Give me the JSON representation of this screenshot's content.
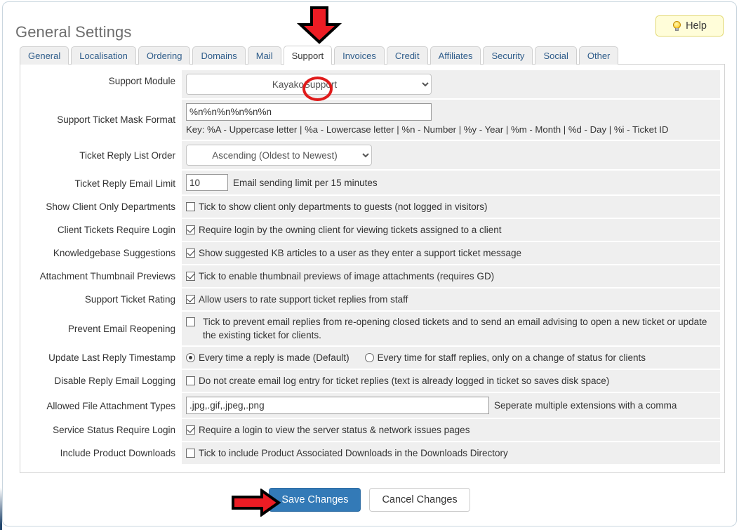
{
  "page": {
    "title": "General Settings",
    "help_button": {
      "label": "Help",
      "icon": "lightbulb-icon"
    }
  },
  "tabs": [
    {
      "label": "General",
      "active": false
    },
    {
      "label": "Localisation",
      "active": false
    },
    {
      "label": "Ordering",
      "active": false
    },
    {
      "label": "Domains",
      "active": false
    },
    {
      "label": "Mail",
      "active": false
    },
    {
      "label": "Support",
      "active": true
    },
    {
      "label": "Invoices",
      "active": false
    },
    {
      "label": "Credit",
      "active": false
    },
    {
      "label": "Affiliates",
      "active": false
    },
    {
      "label": "Security",
      "active": false
    },
    {
      "label": "Social",
      "active": false
    },
    {
      "label": "Other",
      "active": false
    }
  ],
  "settings": {
    "support_module": {
      "label": "Support Module",
      "value": "KayakoSupport",
      "options": [
        "KayakoSupport"
      ]
    },
    "ticket_mask_format": {
      "label": "Support Ticket Mask Format",
      "value": "%n%n%n%n%n%n",
      "key_note": "Key: %A - Uppercase letter | %a - Lowercase letter | %n - Number | %y - Year | %m - Month | %d - Day | %i - Ticket ID"
    },
    "reply_list_order": {
      "label": "Ticket Reply List Order",
      "value": "Ascending (Oldest to Newest)",
      "options": [
        "Ascending (Oldest to Newest)"
      ]
    },
    "reply_email_limit": {
      "label": "Ticket Reply Email Limit",
      "value": "10",
      "suffix": "Email sending limit per 15 minutes"
    },
    "show_client_only_departments": {
      "label": "Show Client Only Departments",
      "checked": false,
      "description": "Tick to show client only departments to guests (not logged in visitors)"
    },
    "client_tickets_require_login": {
      "label": "Client Tickets Require Login",
      "checked": true,
      "description": "Require login by the owning client for viewing tickets assigned to a client"
    },
    "knowledgebase_suggestions": {
      "label": "Knowledgebase Suggestions",
      "checked": true,
      "description": "Show suggested KB articles to a user as they enter a support ticket message"
    },
    "attachment_thumbnail_previews": {
      "label": "Attachment Thumbnail Previews",
      "checked": true,
      "description": "Tick to enable thumbnail previews of image attachments (requires GD)"
    },
    "support_ticket_rating": {
      "label": "Support Ticket Rating",
      "checked": true,
      "description": "Allow users to rate support ticket replies from staff"
    },
    "prevent_email_reopening": {
      "label": "Prevent Email Reopening",
      "checked": false,
      "description": "Tick to prevent email replies from re-opening closed tickets and to send an email advising to open a new ticket or update the existing ticket for clients."
    },
    "update_last_reply_timestamp": {
      "label": "Update Last Reply Timestamp",
      "option_1": "Every time a reply is made (Default)",
      "option_1_selected": true,
      "option_2": "Every time for staff replies, only on a change of status for clients",
      "option_2_selected": false
    },
    "disable_reply_email_logging": {
      "label": "Disable Reply Email Logging",
      "checked": false,
      "description": "Do not create email log entry for ticket replies (text is already logged in ticket so saves disk space)"
    },
    "allowed_file_attachment_types": {
      "label": "Allowed File Attachment Types",
      "value": ".jpg,.gif,.jpeg,.png",
      "suffix": "Seperate multiple extensions with a comma"
    },
    "service_status_require_login": {
      "label": "Service Status Require Login",
      "checked": true,
      "description": "Require a login to view the server status & network issues pages"
    },
    "include_product_downloads": {
      "label": "Include Product Downloads",
      "checked": false,
      "description": "Tick to include Product Associated Downloads in the Downloads Directory"
    }
  },
  "footer": {
    "save_label": "Save Changes",
    "cancel_label": "Cancel Changes"
  },
  "annotations": {
    "color": "#e01b1b",
    "arrow_down_target": "Support",
    "arrow_right_target": "Save Changes",
    "circle_target": "Support Module dropdown arrow"
  }
}
